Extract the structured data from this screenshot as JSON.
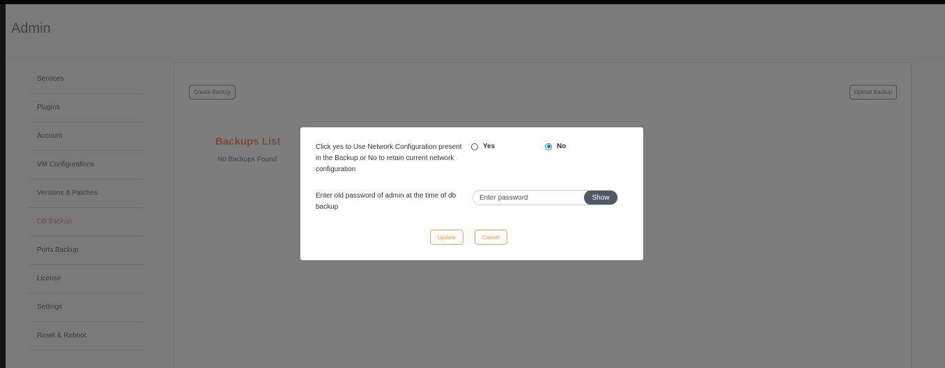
{
  "page": {
    "title": "Admin"
  },
  "sidebar": {
    "items": [
      {
        "label": "Services",
        "active": false
      },
      {
        "label": "Plugins",
        "active": false
      },
      {
        "label": "Account",
        "active": false
      },
      {
        "label": "VM Configurations",
        "active": false
      },
      {
        "label": "Versions & Patches",
        "active": false
      },
      {
        "label": "DB Backup",
        "active": true
      },
      {
        "label": "Ports Backup",
        "active": false
      },
      {
        "label": "License",
        "active": false
      },
      {
        "label": "Settings",
        "active": false
      },
      {
        "label": "Reset & Reboot",
        "active": false
      }
    ]
  },
  "main": {
    "create_backup_label": "Create Backup",
    "upload_backup_label": "Upload Backup",
    "backups_title": "Backups List",
    "no_backups_text": "No Backups Found"
  },
  "modal": {
    "network_question": "Click yes to Use Network Configuration present in the Backup or No to retain current network configuration",
    "yes_label": "Yes",
    "no_label": "No",
    "selected": "No",
    "password_question": "Enter old password of admin at the time of db backup",
    "password_placeholder": "Enter password",
    "password_value": "",
    "show_label": "Show",
    "update_label": "Update",
    "cancel_label": "Cancel"
  },
  "colors": {
    "accent": "#e8a070",
    "radio_selected": "#1a73e8",
    "show_button": "#505a66",
    "action_border": "#f0a348"
  }
}
